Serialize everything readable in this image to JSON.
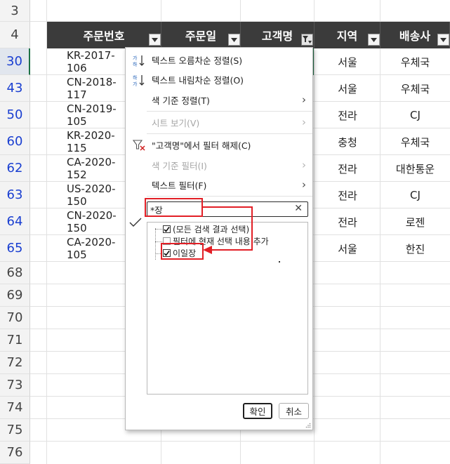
{
  "row_numbers": [
    {
      "label": "3",
      "state": "normal"
    },
    {
      "label": "4",
      "state": "normal"
    },
    {
      "label": "30",
      "state": "selected"
    },
    {
      "label": "43",
      "state": "filtered"
    },
    {
      "label": "50",
      "state": "filtered"
    },
    {
      "label": "60",
      "state": "filtered"
    },
    {
      "label": "62",
      "state": "filtered"
    },
    {
      "label": "63",
      "state": "filtered"
    },
    {
      "label": "64",
      "state": "filtered"
    },
    {
      "label": "65",
      "state": "filtered"
    },
    {
      "label": "68",
      "state": "normal"
    },
    {
      "label": "69",
      "state": "normal"
    },
    {
      "label": "70",
      "state": "normal"
    },
    {
      "label": "71",
      "state": "normal"
    },
    {
      "label": "72",
      "state": "normal"
    },
    {
      "label": "73",
      "state": "normal"
    },
    {
      "label": "74",
      "state": "normal"
    },
    {
      "label": "75",
      "state": "normal"
    },
    {
      "label": "76",
      "state": "normal"
    }
  ],
  "headers": [
    "주문번호",
    "주문일",
    "고객명",
    "지역",
    "배송사"
  ],
  "rows": [
    {
      "order_no": "KR-2017-106",
      "region": "서울",
      "carrier": "우체국"
    },
    {
      "order_no": "CN-2018-117",
      "region": "서울",
      "carrier": "우체국"
    },
    {
      "order_no": "CN-2019-105",
      "region": "전라",
      "carrier": "CJ"
    },
    {
      "order_no": "KR-2020-115",
      "region": "충청",
      "carrier": "우체국"
    },
    {
      "order_no": "CA-2020-152",
      "region": "전라",
      "carrier": "대한통운"
    },
    {
      "order_no": "US-2020-150",
      "region": "전라",
      "carrier": "CJ"
    },
    {
      "order_no": "CN-2020-150",
      "region": "전라",
      "carrier": "로젠"
    },
    {
      "order_no": "CA-2020-105",
      "region": "서울",
      "carrier": "한진"
    }
  ],
  "menu": {
    "sort_asc": "텍스트 오름차순 정렬(S)",
    "sort_desc": "텍스트 내림차순 정렬(O)",
    "sort_color": "색 기준 정렬(T)",
    "sheet_view": "시트 보기(V)",
    "clear_filter": "\"고객명\"에서 필터 해제(C)",
    "filter_color": "색 기준 필터(I)",
    "text_filter": "텍스트 필터(F)"
  },
  "search": {
    "value": "*장"
  },
  "tree": {
    "select_all": "(모든 검색 결과 선택)",
    "add_current": "필터에 현재 선택 내용 추가",
    "item": "이일장"
  },
  "buttons": {
    "ok": "확인",
    "cancel": "취소"
  },
  "colors": {
    "header_bg": "#3b3b3b",
    "annotation_red": "#e21f26",
    "filtered_row_number": "#1a3fd1",
    "selection_green": "#1e7145"
  }
}
